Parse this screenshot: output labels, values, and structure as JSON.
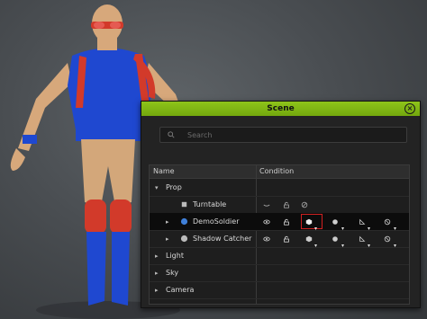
{
  "panel": {
    "title": "Scene",
    "search_placeholder": "Search",
    "columns": {
      "name": "Name",
      "condition": "Condition"
    },
    "rows": [
      {
        "label": "Prop",
        "expanded": true
      },
      {
        "label": "Turntable"
      },
      {
        "label": "DemoSoldier",
        "selected": true
      },
      {
        "label": "Shadow Catcher"
      },
      {
        "label": "Light"
      },
      {
        "label": "Sky"
      },
      {
        "label": "Camera"
      }
    ]
  },
  "colors": {
    "titlebar": "#7fb613",
    "highlight_box": "#d02020",
    "figure_shirt": "#1f48d0",
    "figure_accent": "#d23a2a"
  },
  "icons": {
    "close": "close-circle-icon",
    "search": "search-icon",
    "visibility": "eye-icon",
    "lock": "lock-icon",
    "cube": "cube-icon",
    "sphere": "sphere-icon",
    "triangle": "triangle-icon",
    "no": "no-circle-icon"
  }
}
